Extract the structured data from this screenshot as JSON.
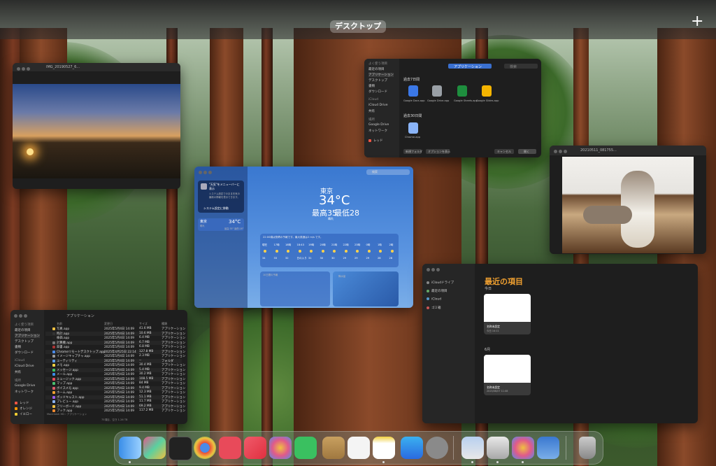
{
  "spaces": {
    "label": "デスクトップ",
    "add_label": "+"
  },
  "photo_window": {
    "title": "IMG_20190527_6..."
  },
  "finder_dialog": {
    "sidebar_header": "よく使う項目",
    "sidebar": [
      "最近の項目",
      "アプリケーション",
      "デスクトップ",
      "書類",
      "ダウンロード"
    ],
    "icloud_header": "iCloud",
    "icloud_items": [
      "iCloud Drive",
      "共有"
    ],
    "location_header": "場所",
    "location_items": [
      "Google Drive",
      "ネットワーク"
    ],
    "tag_items": [
      "レッド"
    ],
    "path": "アプリケーション",
    "search_placeholder": "検索",
    "section1": "過去7日間",
    "apps": [
      {
        "name": "Google Docs.app",
        "color": "#3b78e7"
      },
      {
        "name": "Google Drive.app",
        "color": "#9aa0a6"
      },
      {
        "name": "Google Sheets.app",
        "color": "#1e8e3e"
      },
      {
        "name": "Google Slides.app",
        "color": "#f4b400"
      }
    ],
    "section2": "過去30日間",
    "apps2": [
      {
        "name": "Chrome.app",
        "color": "#8ab4f8"
      }
    ],
    "new_folder_label": "新規フォルダ",
    "options_label": "オプションを表示",
    "cancel_label": "キャンセル",
    "open_label": "開く"
  },
  "cat_window": {
    "title": "20210511_081755..."
  },
  "weather_window": {
    "search_placeholder": "検索",
    "card_title": "\"天気\"をメニューバーに表示",
    "card_body": "システム設定でのまま天気の最新の情報を表示できます。",
    "card_button": "システム設定に移動",
    "location_item": "東京",
    "location_sub": "晴れ",
    "location_temp": "34°C",
    "location_range": "最高:35° 最低:28°",
    "city": "東京",
    "temp": "34°C",
    "high": "最高35",
    "low": "最低28",
    "condition": "晴れ",
    "forecast_banner": "22:00頃は快晴の予報です。最大風速は2 m/s です。",
    "hours": [
      "現在",
      "17時",
      "18時",
      "18:43",
      "19時",
      "20時",
      "21時",
      "22時",
      "23時",
      "0時",
      "1時",
      "2時"
    ],
    "hour_temps": [
      "34",
      "33",
      "32",
      "日の入り",
      "31",
      "30",
      "30",
      "29",
      "29",
      "29",
      "28",
      "28"
    ],
    "daily_header": "10日間の予報",
    "map_label": "降水量"
  },
  "apps_finder": {
    "title": "アプリケーション",
    "sidebar_header": "よく使う項目",
    "sidebar": [
      "最近の項目",
      "アプリケーション",
      "デスクトップ",
      "書類",
      "ダウンロード"
    ],
    "icloud_header": "iCloud",
    "icloud_items": [
      "iCloud Drive",
      "共有"
    ],
    "location_header": "場所",
    "location_items": [
      "Google Drive",
      "ネットワーク"
    ],
    "tag_items": [
      "レッド",
      "オレンジ",
      "イエロー"
    ],
    "columns": [
      "名前",
      "変更日",
      "サイズ",
      "種類"
    ],
    "rows": [
      {
        "name": "写真.app",
        "date": "2025年5月4日 14:09",
        "size": "41.6 MB",
        "kind": "アプリケーション"
      },
      {
        "name": "時計.app",
        "date": "2025年5月4日 14:09",
        "size": "10.6 MB",
        "kind": "アプリケーション"
      },
      {
        "name": "株価.app",
        "date": "2025年5月4日 14:09",
        "size": "6.4 MB",
        "kind": "アプリケーション"
      },
      {
        "name": "計算機.app",
        "date": "2025年5月4日 14:09",
        "size": "6.7 MB",
        "kind": "アプリケーション"
      },
      {
        "name": "辞書.app",
        "date": "2025年5月4日 14:09",
        "size": "6.8 MB",
        "kind": "アプリケーション"
      },
      {
        "name": "Chromeリモートデスクトップ.app",
        "date": "2025年4月25日 22:14",
        "size": "127.8 MB",
        "kind": "アプリケーション"
      },
      {
        "name": "イメージキャプチャ.app",
        "date": "2025年5月4日 14:09",
        "size": "2.3 MB",
        "kind": "アプリケーション"
      },
      {
        "name": "ユーティリティ",
        "date": "2025年5月4日 14:09",
        "size": "--",
        "kind": "フォルダ"
      },
      {
        "name": "メモ.app",
        "date": "2025年5月4日 14:09",
        "size": "30.4 MB",
        "kind": "アプリケーション"
      },
      {
        "name": "メッセージ.app",
        "date": "2025年5月4日 14:09",
        "size": "5.4 MB",
        "kind": "アプリケーション"
      },
      {
        "name": "メール.app",
        "date": "2025年5月4日 14:09",
        "size": "30.2 MB",
        "kind": "アプリケーション"
      },
      {
        "name": "ミュージック.app",
        "date": "2025年5月4日 14:09",
        "size": "108.5 MB",
        "kind": "アプリケーション"
      },
      {
        "name": "マップ.app",
        "date": "2025年5月4日 14:09",
        "size": "84 MB",
        "kind": "アプリケーション"
      },
      {
        "name": "ボイスメモ.app",
        "date": "2025年5月4日 14:09",
        "size": "9.4 MB",
        "kind": "アプリケーション"
      },
      {
        "name": "ホーム.app",
        "date": "2025年5月4日 14:09",
        "size": "12.3 MB",
        "kind": "アプリケーション"
      },
      {
        "name": "ポッドキャスト.app",
        "date": "2025年5月4日 14:09",
        "size": "51.1 MB",
        "kind": "アプリケーション"
      },
      {
        "name": "プレビュー.app",
        "date": "2025年5月4日 14:09",
        "size": "11.7 MB",
        "kind": "アプリケーション"
      },
      {
        "name": "フリーボード.app",
        "date": "2025年5月4日 14:09",
        "size": "69.2 MB",
        "kind": "アプリケーション"
      },
      {
        "name": "ブック.app",
        "date": "2025年5月4日 14:09",
        "size": "117.2 MB",
        "kind": "アプリケーション"
      }
    ],
    "path_bar": "Macintosh HD › アプリケーション",
    "status": "75項目、空き 1.26 TB"
  },
  "notes_window": {
    "sidebar": [
      "iCloudドライブ",
      "最近の項目",
      "iCloud",
      "ゴミ箱"
    ],
    "section_title": "最近の項目",
    "group1": "今日",
    "group2": "6月",
    "card1_title": "名称未設定",
    "card1_sub": "今日 14:11",
    "card2_title": "名称未設定",
    "card2_sub": "2025/06/07 11:08"
  },
  "dock": {
    "apps": [
      "finder-icon",
      "launchpad-icon",
      "mission-control-icon",
      "chrome-icon",
      "safari-icon",
      "music-icon",
      "photos-icon",
      "messages-icon",
      "notes-icon",
      "reminders-icon",
      "stickies-icon",
      "app-store-icon",
      "settings-icon"
    ],
    "recent": [
      "preview-icon",
      "files-icon",
      "photos-recent-icon",
      "weather-icon"
    ],
    "trash": "trash-icon"
  }
}
